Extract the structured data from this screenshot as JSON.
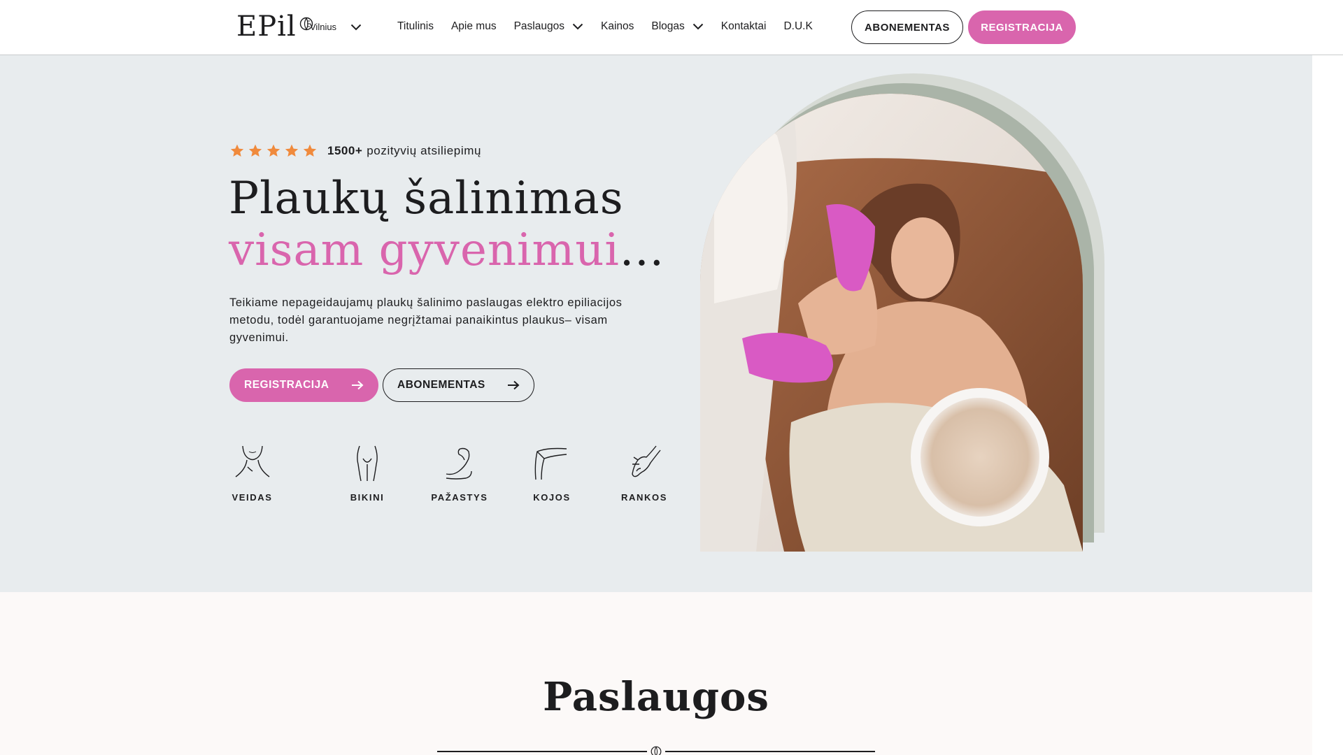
{
  "header": {
    "logo_text": "EPil",
    "city": "Vilnius",
    "nav": [
      {
        "label": "Titulinis",
        "has_dropdown": false
      },
      {
        "label": "Apie mus",
        "has_dropdown": false
      },
      {
        "label": "Paslaugos",
        "has_dropdown": true
      },
      {
        "label": "Kainos",
        "has_dropdown": false
      },
      {
        "label": "Blogas",
        "has_dropdown": true
      },
      {
        "label": "Kontaktai",
        "has_dropdown": false
      },
      {
        "label": "D.U.K",
        "has_dropdown": false
      }
    ],
    "subscription_button": "ABONEMENTAS",
    "register_button": "REGISTRACIJA"
  },
  "hero": {
    "rating_stars": 5,
    "reviews_count": "1500+",
    "reviews_text": "pozityvių atsiliepimų",
    "title_line1": "Plaukų šalinimas",
    "title_line2_pink": "visam gyvenimui",
    "title_line2_suffix": "...",
    "description": "Teikiame nepageidaujamų plaukų šalinimo paslaugas elektro epiliacijos metodu, todėl garantuojame negrįžtamai panaikintus plaukus– visam gyvenimui.",
    "register_button": "REGISTRACIJA",
    "subscription_button": "ABONEMENTAS",
    "areas": [
      {
        "label": "VEIDAS",
        "icon": "face-neck-icon"
      },
      {
        "label": "BIKINI",
        "icon": "bikini-icon"
      },
      {
        "label": "PAŽASTYS",
        "icon": "armpit-icon"
      },
      {
        "label": "KOJOS",
        "icon": "legs-icon"
      },
      {
        "label": "RANKOS",
        "icon": "hands-icon"
      }
    ]
  },
  "services": {
    "title": "Paslaugos"
  },
  "colors": {
    "accent_pink": "#d965ad",
    "star_orange": "#f08a3c",
    "hero_bg": "#e8ecee",
    "arch_sage": "#aab4a8",
    "text_dark": "#1d1d1f"
  }
}
